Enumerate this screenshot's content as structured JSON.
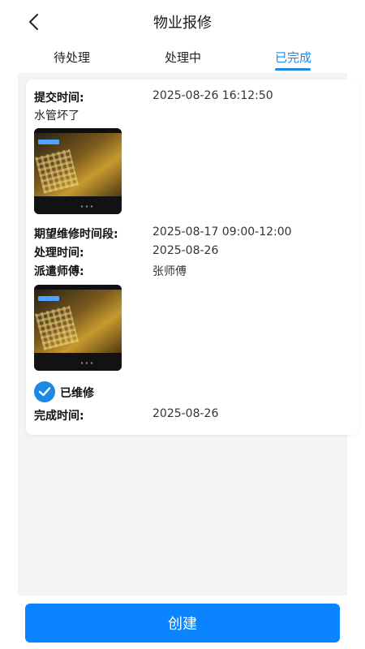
{
  "header": {
    "title": "物业报修",
    "back_icon": "chevron-left-icon"
  },
  "tabs": [
    {
      "label": "待处理",
      "active": false
    },
    {
      "label": "处理中",
      "active": false
    },
    {
      "label": "已完成",
      "active": true
    }
  ],
  "colors": {
    "accent": "#1e88e5",
    "button": "#0b84ff",
    "background": "#f4f4f5"
  },
  "card": {
    "submit_time_label": "提交时间:",
    "submit_time_value": "2025-08-26 16:12:50",
    "description": "水管坏了",
    "expected_time_label": "期望维修时间段:",
    "expected_time_value": "2025-08-17 09:00-12:00",
    "process_time_label": "处理时间:",
    "process_time_value": "2025-08-26",
    "worker_label": "派遣师傅:",
    "worker_value": "张师傅",
    "status_icon": "check-circle-icon",
    "status_label": "已维修",
    "finish_time_label": "完成时间:",
    "finish_time_value": "2025-08-26"
  },
  "footer": {
    "create_label": "创建"
  }
}
